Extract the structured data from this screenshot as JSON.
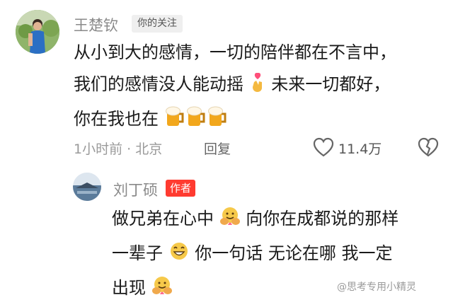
{
  "comment": {
    "username": "王楚钦",
    "follow_tag": "你的关注",
    "lines": [
      "从小到大的感情，一切的陪伴都在不言中，",
      "我们的感情没人能动摇",
      "未来一切都好，",
      "你在我也在"
    ],
    "time_location": "1小时前 · 北京",
    "reply_label": "回复",
    "like_count": "11.4万"
  },
  "reply": {
    "username": "刘丁硕",
    "author_tag": "作者",
    "lines": [
      "做兄弟在心中",
      "向你在成都说的那样",
      "一辈子",
      "你一句话 无论在哪 我一定",
      "出现"
    ]
  },
  "watermark": "@思考专用小精灵",
  "icons": [
    "heart-icon",
    "dislike-icon",
    "beer-icon",
    "hug-icon",
    "grin-icon",
    "finger-heart-icon"
  ]
}
